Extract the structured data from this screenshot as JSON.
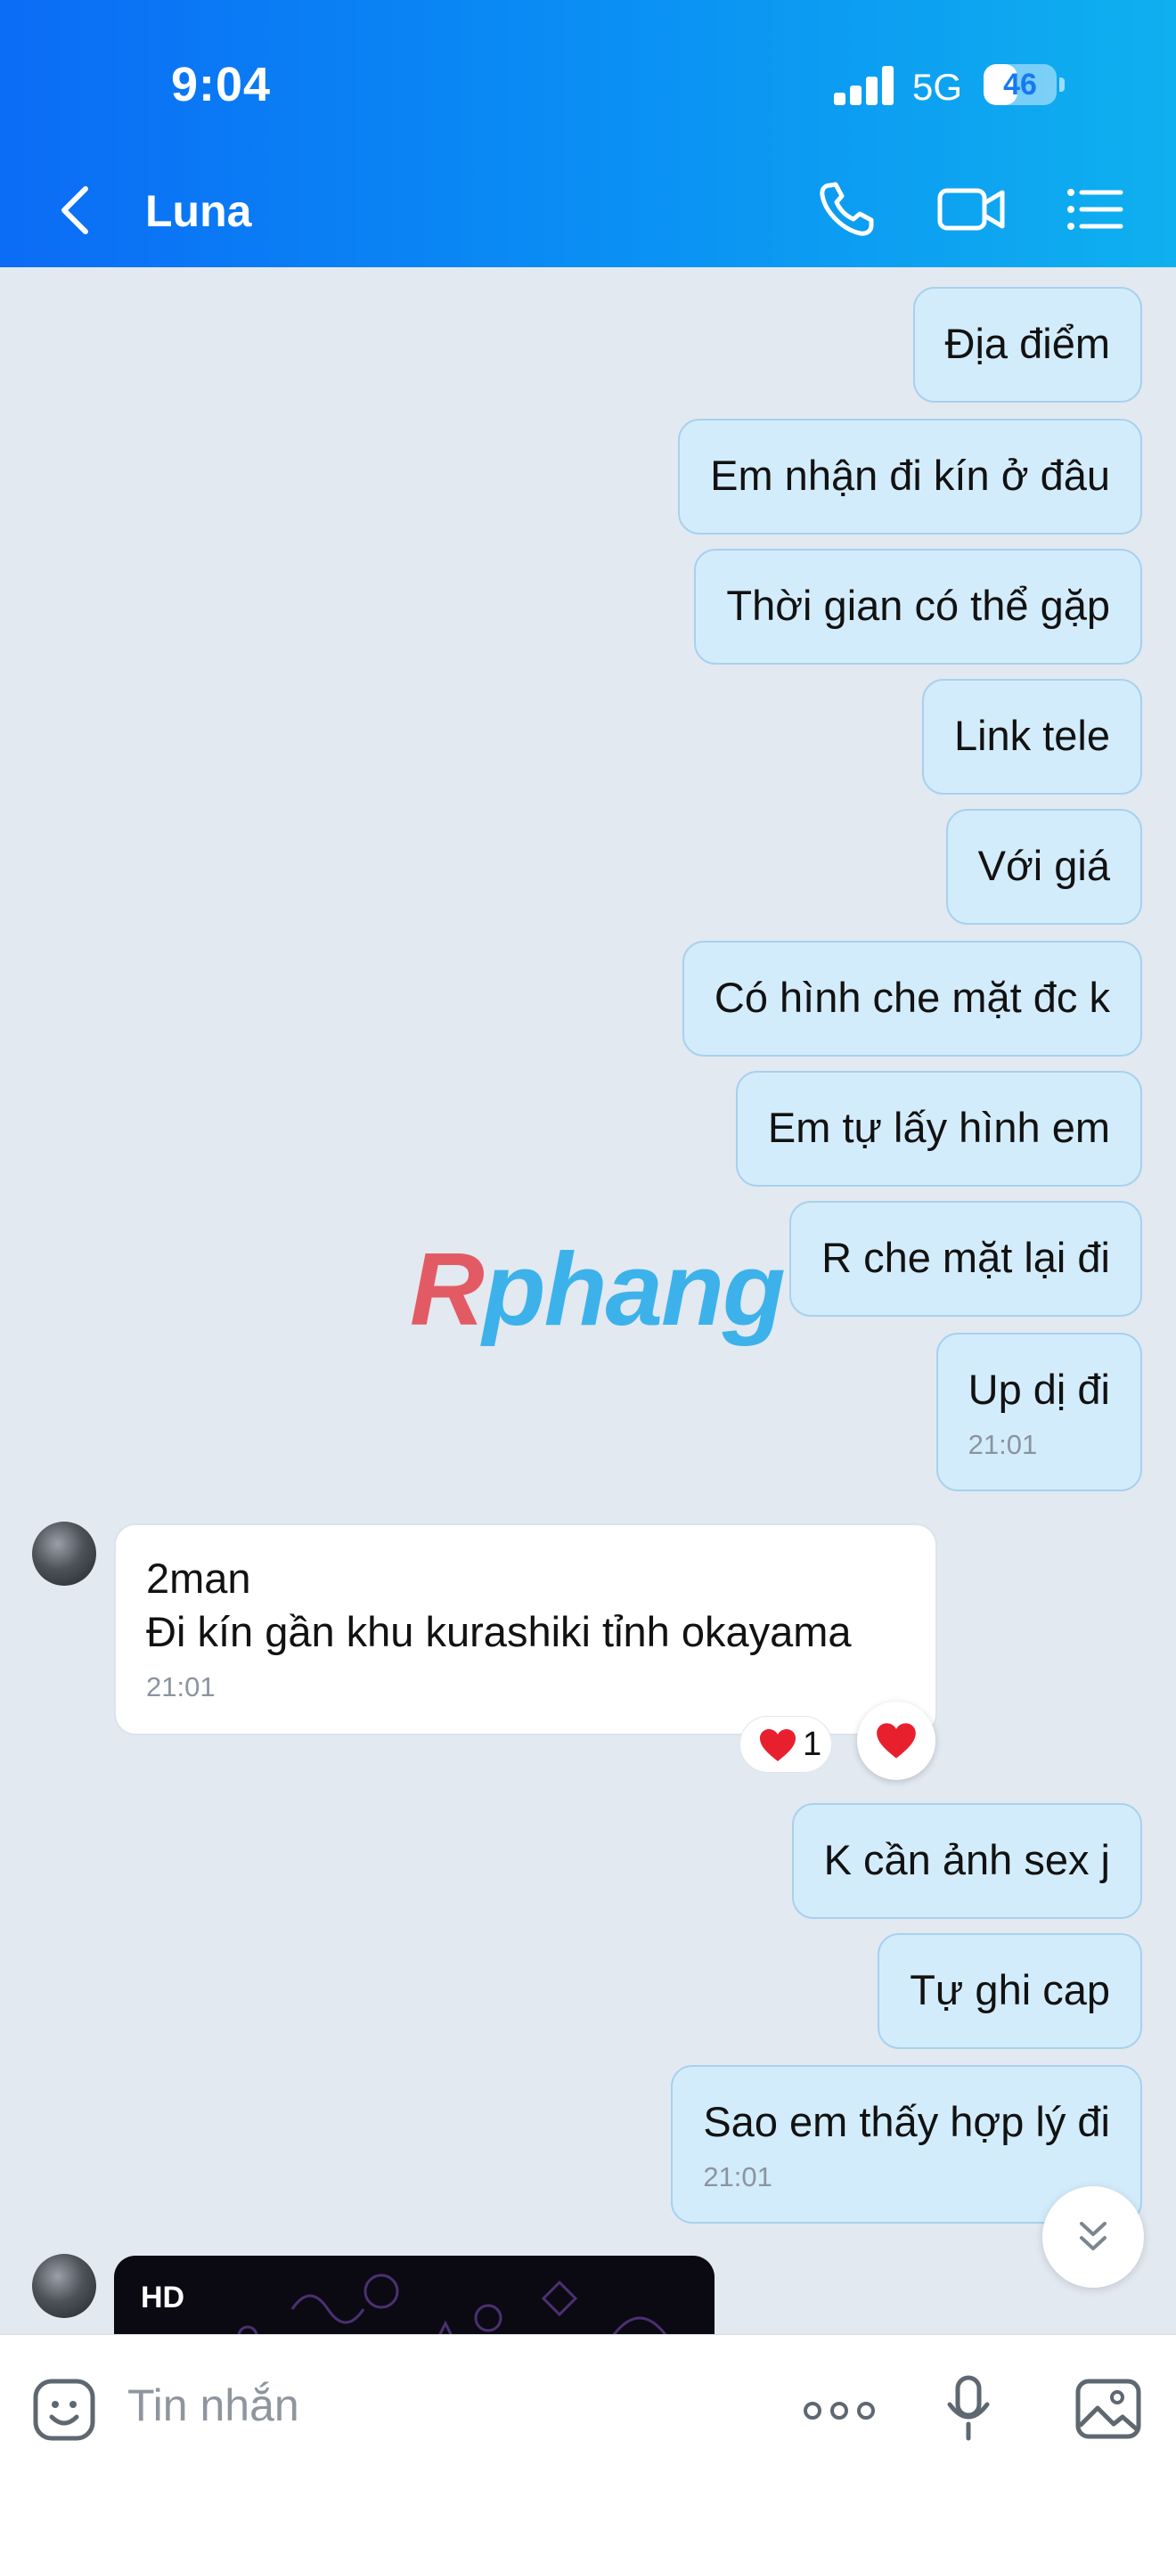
{
  "status_bar": {
    "time": "9:04",
    "network": "5G",
    "battery": "46",
    "battery_level": 0.46
  },
  "header": {
    "contact_name": "Luna"
  },
  "messages": {
    "m1": "Địa điểm",
    "m2": "Em nhận đi kín ở đâu",
    "m3": "Thời gian có thể gặp",
    "m4": "Link tele",
    "m5": "Với giá",
    "m6": "Có hình che mặt đc k",
    "m7": "Em tự lấy hình em",
    "m8": "R che mặt lại đi",
    "m9": "Up dị đi",
    "m9_time": "21:01",
    "in1_line1": "2man",
    "in1_line2": "Đi kín gần khu kurashiki tỉnh okayama",
    "in1_time": "21:01",
    "in1_reaction_count": "1",
    "m10": "K cần ảnh sex j",
    "m11": "Tự ghi cap",
    "m12": "Sao em thấy hợp lý đi",
    "m12_time": "21:01",
    "media_badge": "HD"
  },
  "watermark": {
    "part1": "R",
    "part2": "phang"
  },
  "input": {
    "placeholder": "Tin nhắn"
  },
  "colors": {
    "header_start": "#0b6cf5",
    "header_end": "#0fb0ef",
    "outgoing_bubble": "#d3ecfb",
    "incoming_bubble": "#ffffff",
    "chat_bg": "#e2e9f1",
    "heart": "#e8202e"
  }
}
